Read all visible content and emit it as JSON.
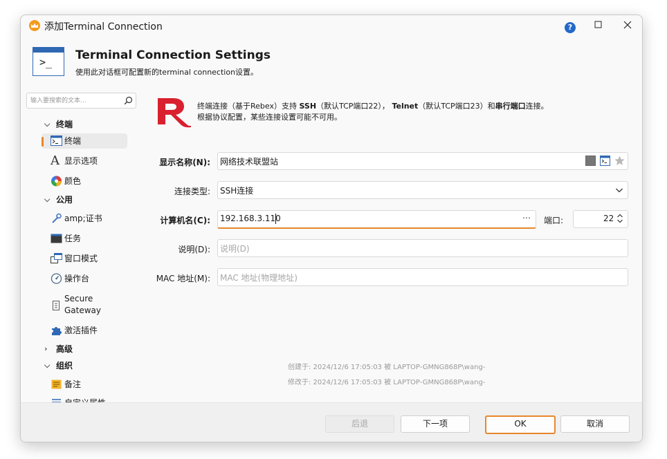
{
  "window": {
    "title": "添加Terminal Connection"
  },
  "header": {
    "title": "Terminal Connection Settings",
    "subtitle": "使用此对话框可配置新的terminal connection设置。",
    "icon_prompt": ">_"
  },
  "sidebar": {
    "search_placeholder": "输入要搜索的文本...",
    "groups": [
      {
        "label": "终端",
        "items": [
          {
            "label": "终端",
            "icon": "terminal-icon"
          },
          {
            "label": "显示选项",
            "icon": "font-icon"
          },
          {
            "label": "颜色",
            "icon": "palette-icon"
          }
        ]
      },
      {
        "label": "公用",
        "items": [
          {
            "label": "amp;证书",
            "icon": "certificate-icon"
          },
          {
            "label": "任务",
            "icon": "task-icon"
          },
          {
            "label": "窗口模式",
            "icon": "window-mode-icon"
          },
          {
            "label": "操作台",
            "icon": "console-icon"
          },
          {
            "label_line1": "Secure",
            "label_line2": "Gateway",
            "icon": "gateway-icon"
          },
          {
            "label": "激活插件",
            "icon": "plugin-icon"
          }
        ]
      },
      {
        "label": "高级"
      },
      {
        "label": "组织",
        "items": [
          {
            "label": "备注",
            "icon": "notes-icon"
          },
          {
            "label": "自定义属性",
            "icon": "custom-properties-icon"
          }
        ]
      }
    ]
  },
  "info": {
    "part1": "终端连接（基于Rebex）支持 ",
    "ssh": "SSH",
    "part2": "（默认TCP端口22），",
    "telnet": "Telnet",
    "part3": "（默认TCP端口23）和",
    "serial": "串行端口",
    "part4": "连接。",
    "line2": "根据协议配置，某些连接设置可能不可用。"
  },
  "form": {
    "display_name_label": "显示名称(N):",
    "display_name_value": "网络技术联盟站",
    "connection_type_label": "连接类型:",
    "connection_type_value": "SSH连接",
    "computer_name_label": "计算机名(C):",
    "computer_name_value": "192.168.3.110",
    "port_label": "端口:",
    "port_value": "22",
    "description_label": "说明(D):",
    "description_placeholder": "说明(D)",
    "mac_label": "MAC 地址(M):",
    "mac_placeholder": "MAC 地址(物理地址)"
  },
  "meta": {
    "created": "创建于: 2024/12/6 17:05:03 被 LAPTOP-GMNG868P\\wang-",
    "modified": "修改于: 2024/12/6 17:05:03 被 LAPTOP-GMNG868P\\wang-"
  },
  "footer": {
    "back": "后退",
    "next": "下一项",
    "ok": "OK",
    "cancel": "取消"
  },
  "colors": {
    "accent": "#e8862b",
    "rebex_red": "#d9202e",
    "brand_blue": "#2f68b3"
  }
}
